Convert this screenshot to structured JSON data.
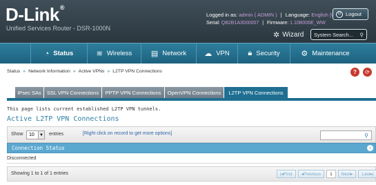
{
  "header": {
    "logo": "D-Link",
    "logo_mark": "®",
    "tagline": "Unified Services Router - DSR-1000N",
    "logged_label": "Logged in as:",
    "logged_user": "admin ( ADMIN )",
    "language_label": "Language:",
    "language_value": "English [US]",
    "serial_label": "Serial:",
    "serial_value": "QB2B1A3000007",
    "firmware_label": "Firmware:",
    "firmware_value": "1.10B006E_WW",
    "logout_label": "Logout",
    "wizard_label": "Wizard",
    "system_search_placeholder": "System Search..."
  },
  "nav": [
    {
      "label": "Status",
      "icon": "speedometer-icon",
      "active": true
    },
    {
      "label": "Wireless",
      "icon": "wifi-icon",
      "active": false
    },
    {
      "label": "Network",
      "icon": "network-icon",
      "active": false
    },
    {
      "label": "VPN",
      "icon": "vpn-icon",
      "active": false
    },
    {
      "label": "Security",
      "icon": "lock-icon",
      "active": false
    },
    {
      "label": "Maintenance",
      "icon": "gears-icon",
      "active": false
    }
  ],
  "breadcrumb": [
    "Status",
    "Network Information",
    "Active VPNs",
    "L2TP VPN Connections"
  ],
  "tabs": [
    {
      "label": "IPsec SAs",
      "active": false
    },
    {
      "label": "SSL VPN Connections",
      "active": false
    },
    {
      "label": "PPTP VPN Connections",
      "active": false
    },
    {
      "label": "OpenVPN Connections",
      "active": false
    },
    {
      "label": "L2TP VPN Connections",
      "active": true
    }
  ],
  "description": "This page lists current established L2TP VPN tunnels.",
  "section_title": "Active L2TP VPN Connections",
  "table": {
    "show_label": "Show",
    "entries_value": "10",
    "entries_label": "entries",
    "hint": "[Right click on record to get more options]",
    "column_header": "Connection Status",
    "rows": [
      "Disconnected"
    ],
    "showing": "Showing 1 to 1 of 1 entries",
    "pager": {
      "first": "First",
      "previous": "Previous",
      "current": "1",
      "next": "Next",
      "last": "Last"
    }
  },
  "colors": {
    "header_bg": "#2b373f",
    "nav_bg": "#1d6280",
    "accent_blue": "#2f7fa3",
    "table_header": "#5aa7d0",
    "help_red": "#c73a2e"
  }
}
